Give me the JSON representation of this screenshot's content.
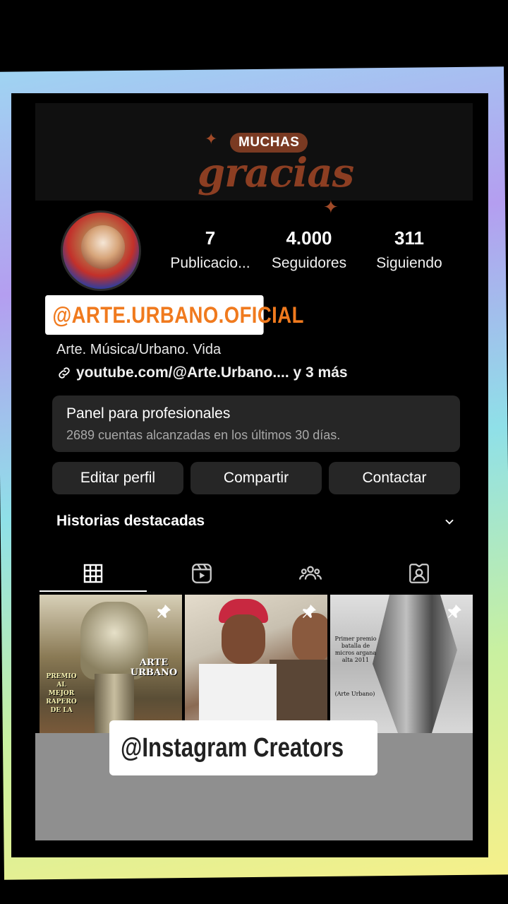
{
  "banner": {
    "badge": "MUCHAS",
    "script": "gracias"
  },
  "profile": {
    "stats": [
      {
        "value": "7",
        "label": "Publicacio..."
      },
      {
        "value": "4.000",
        "label": "Seguidores"
      },
      {
        "value": "311",
        "label": "Siguiendo"
      }
    ],
    "username": "@ARTE.URBANO.OFICIAL",
    "bio": "Arte. Música/Urbano. Vida",
    "link": "youtube.com/@Arte.Urbano.... y 3 más"
  },
  "pro_panel": {
    "title": "Panel para profesionales",
    "subtitle": "2689 cuentas alcanzadas en los últimos 30 días."
  },
  "actions": {
    "edit": "Editar perfil",
    "share": "Compartir",
    "contact": "Contactar"
  },
  "highlights": {
    "label": "Historias destacadas"
  },
  "tabs": [
    "grid-icon",
    "reels-icon",
    "collab-icon",
    "tagged-icon"
  ],
  "posts": [
    {
      "overlay_1": "ARTE URBANO",
      "overlay_2": "PREMIO AL MEJOR RAPERO DE LA"
    },
    {
      "overlay_1": ""
    },
    {
      "overlay_1": "Primer premio batalla de micros argana alta 2011",
      "overlay_2": "(Arte Urbano)"
    }
  ],
  "overlay_caption": "@Instagram Creators",
  "colors": {
    "accent_orange": "#f07a1e",
    "banner_brown": "#8c3e22",
    "card_gray": "#262626"
  }
}
